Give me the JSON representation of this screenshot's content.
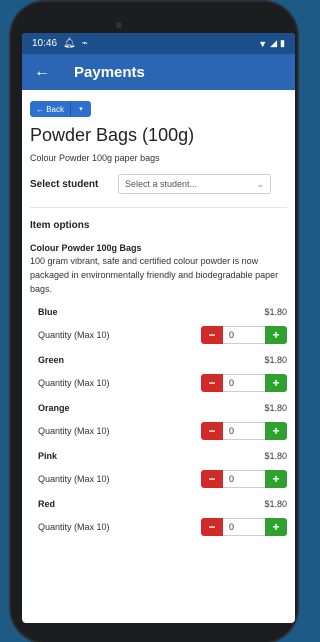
{
  "status_bar": {
    "time": "10:46",
    "icons": [
      "bell-icon",
      "cast-icon"
    ],
    "right_icons": [
      "wifi-icon",
      "signal-icon",
      "battery-icon"
    ]
  },
  "app_bar": {
    "title": "Payments",
    "back_icon": "arrow-left-icon"
  },
  "back_button": {
    "label": "← Back",
    "dropdown": "▾"
  },
  "product": {
    "title": "Powder Bags (100g)",
    "subtitle": "Colour Powder 100g paper bags"
  },
  "student": {
    "label": "Select student",
    "placeholder": "Select a student..."
  },
  "item_options": {
    "title": "Item options",
    "desc_title": "Colour Powder 100g Bags",
    "desc_text": "100 gram vibrant, safe and certified colour powder is now packaged in environmentally friendly and biodegradable paper bags."
  },
  "options": [
    {
      "name": "Blue",
      "price": "$1.80",
      "qty_label": "Quantity (Max 10)",
      "qty": "0"
    },
    {
      "name": "Green",
      "price": "$1.80",
      "qty_label": "Quantity (Max 10)",
      "qty": "0"
    },
    {
      "name": "Orange",
      "price": "$1.80",
      "qty_label": "Quantity (Max 10)",
      "qty": "0"
    },
    {
      "name": "Pink",
      "price": "$1.80",
      "qty_label": "Quantity (Max 10)",
      "qty": "0"
    },
    {
      "name": "Red",
      "price": "$1.80",
      "qty_label": "Quantity (Max 10)",
      "qty": "0"
    }
  ],
  "stepper": {
    "minus": "−",
    "plus": "+"
  },
  "colors": {
    "app_bar": "#2a66b3",
    "status_bar": "#1e4f8d",
    "minus": "#d12a2a",
    "plus": "#2ea02e",
    "background": "#1d5a86"
  }
}
